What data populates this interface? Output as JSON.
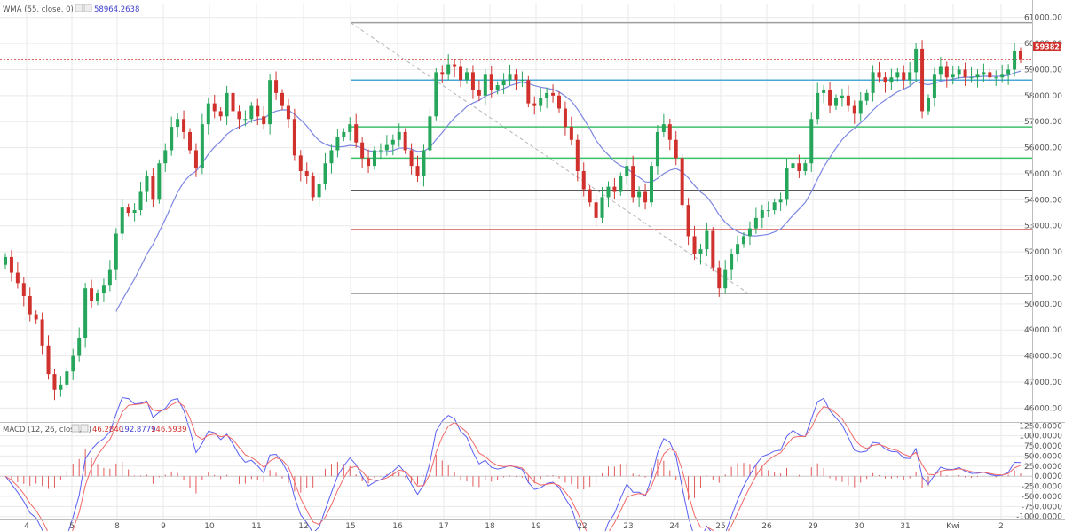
{
  "price_panel": {
    "indicator_label": "WMA (55, close, 0)",
    "indicator_value": "58964.2638",
    "current_price_tag": "59382.33",
    "colors": {
      "up": "#26a65b",
      "down": "#d0312d",
      "wma": "#7b86e0",
      "price_line": "#d0312d"
    }
  },
  "macd_panel": {
    "label": "MACD (12, 26, close, 9)",
    "hist_value": "46.2840",
    "macd_value": "192.8779",
    "signal_value": "146.5939",
    "colors": {
      "macd": "#5a5ef2",
      "signal": "#f26868",
      "hist": "#e05a5a"
    }
  },
  "chart_data": [
    {
      "type": "candlestick",
      "y_tick_labels": [
        "61000.00",
        "60000.00",
        "59000.00",
        "58000.00",
        "57000.00",
        "56000.00",
        "55000.00",
        "54000.00",
        "53000.00",
        "52000.00",
        "51000.00",
        "50000.00",
        "49000.00",
        "48000.00",
        "47000.00",
        "46000.00"
      ],
      "ylim": [
        45500,
        61500
      ],
      "x_tick_labels": [
        "4",
        "5",
        "8",
        "9",
        "10",
        "11",
        "12",
        "15",
        "16",
        "17",
        "18",
        "19",
        "22",
        "23",
        "24",
        "25",
        "26",
        "29",
        "30",
        "31",
        "Kwi",
        "2"
      ],
      "horizontal_levels": [
        {
          "value": 60800,
          "color": "#9e9e9e"
        },
        {
          "value": 58600,
          "color": "#4aa8d8"
        },
        {
          "value": 56800,
          "color": "#3cc06a"
        },
        {
          "value": 55600,
          "color": "#3cc06a"
        },
        {
          "value": 54350,
          "color": "#222222"
        },
        {
          "value": 52850,
          "color": "#d0312d"
        },
        {
          "value": 50400,
          "color": "#9e9e9e"
        }
      ],
      "trendline": {
        "from": [
          15,
          60800
        ],
        "to": [
          25.6,
          50400
        ]
      },
      "current_price": 59382.33,
      "closes": [
        51800,
        51200,
        50800,
        50300,
        49600,
        49400,
        48400,
        47300,
        46700,
        46900,
        47400,
        48000,
        48700,
        50600,
        50100,
        50400,
        50700,
        51300,
        52700,
        53700,
        53500,
        53600,
        54300,
        54900,
        54000,
        55400,
        55900,
        56800,
        57100,
        56600,
        55900,
        55200,
        56900,
        57700,
        57400,
        57200,
        58100,
        57400,
        57100,
        57100,
        57600,
        57200,
        56900,
        58600,
        58100,
        57600,
        57100,
        55700,
        55100,
        54900,
        54100,
        54600,
        55400,
        55900,
        56400,
        56600,
        56900,
        56200,
        55600,
        55300,
        55900,
        55900,
        56100,
        56300,
        56600,
        55900,
        55300,
        54900,
        55900,
        57200,
        58900,
        58800,
        59200,
        59100,
        58600,
        58900,
        58200,
        58000,
        58800,
        58200,
        58400,
        58600,
        58800,
        58600,
        58600,
        57700,
        57600,
        57900,
        58100,
        58000,
        57500,
        56800,
        56300,
        55100,
        54400,
        53900,
        53300,
        54100,
        54500,
        54300,
        54900,
        55300,
        54100,
        54300,
        53900,
        55300,
        56600,
        56900,
        56300,
        55600,
        53800,
        52600,
        51900,
        52100,
        52800,
        51400,
        50600,
        51300,
        51900,
        52300,
        52600,
        52900,
        53300,
        53600,
        53600,
        53900,
        54000,
        55200,
        55400,
        55100,
        55400,
        57100,
        58100,
        58200,
        57600,
        57900,
        58000,
        57600,
        57300,
        57800,
        58100,
        58900,
        58700,
        58500,
        58700,
        58900,
        58600,
        58900,
        59800,
        57400,
        57900,
        58800,
        59100,
        58700,
        58800,
        59000,
        58700,
        58700,
        58800,
        58900,
        58700,
        58700,
        58800,
        59000,
        59700,
        59400
      ]
    },
    {
      "type": "macd",
      "y_tick_labels": [
        "1250.0000",
        "1000.0000",
        "750.0000",
        "500.0000",
        "250.0000",
        "0.0000",
        "-250.0000",
        "-500.0000",
        "-750.0000",
        "-1000.0000"
      ],
      "ylim": [
        -1050,
        1300
      ],
      "zero_line": 0
    }
  ]
}
